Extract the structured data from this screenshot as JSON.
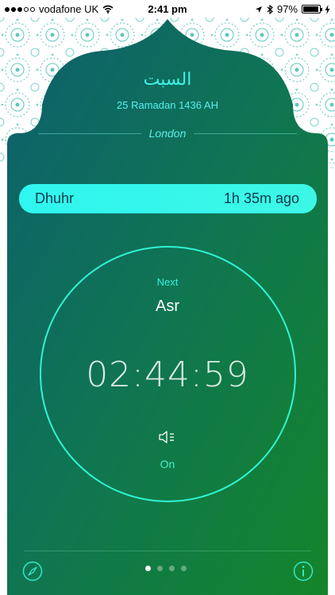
{
  "status_bar": {
    "carrier": "vodafone UK",
    "time": "2:41 pm",
    "battery_percent": "97%",
    "signal_bars_filled": 3,
    "signal_bars_total": 5
  },
  "header": {
    "day_name": "السبت",
    "hijri_date": "25 Ramadan 1436 AH",
    "location": "London"
  },
  "current_prayer": {
    "name": "Dhuhr",
    "elapsed": "1h 35m ago"
  },
  "next_prayer": {
    "label": "Next",
    "name": "Asr",
    "countdown": "02:44:59",
    "alarm_state": "On"
  },
  "pager": {
    "page_count": 4,
    "active_index": 0
  },
  "icons": {
    "compass": "compass-icon",
    "info": "info-icon",
    "speaker": "speaker-icon",
    "wifi": "wifi-icon",
    "location_arrow": "location-arrow-icon",
    "bluetooth": "bluetooth-icon",
    "battery": "battery-icon",
    "charging": "charging-bolt-icon"
  },
  "colors": {
    "accent_cyan": "#2ff6ef",
    "gradient_top": "#0d6b6a",
    "gradient_bottom": "#118a2e"
  }
}
